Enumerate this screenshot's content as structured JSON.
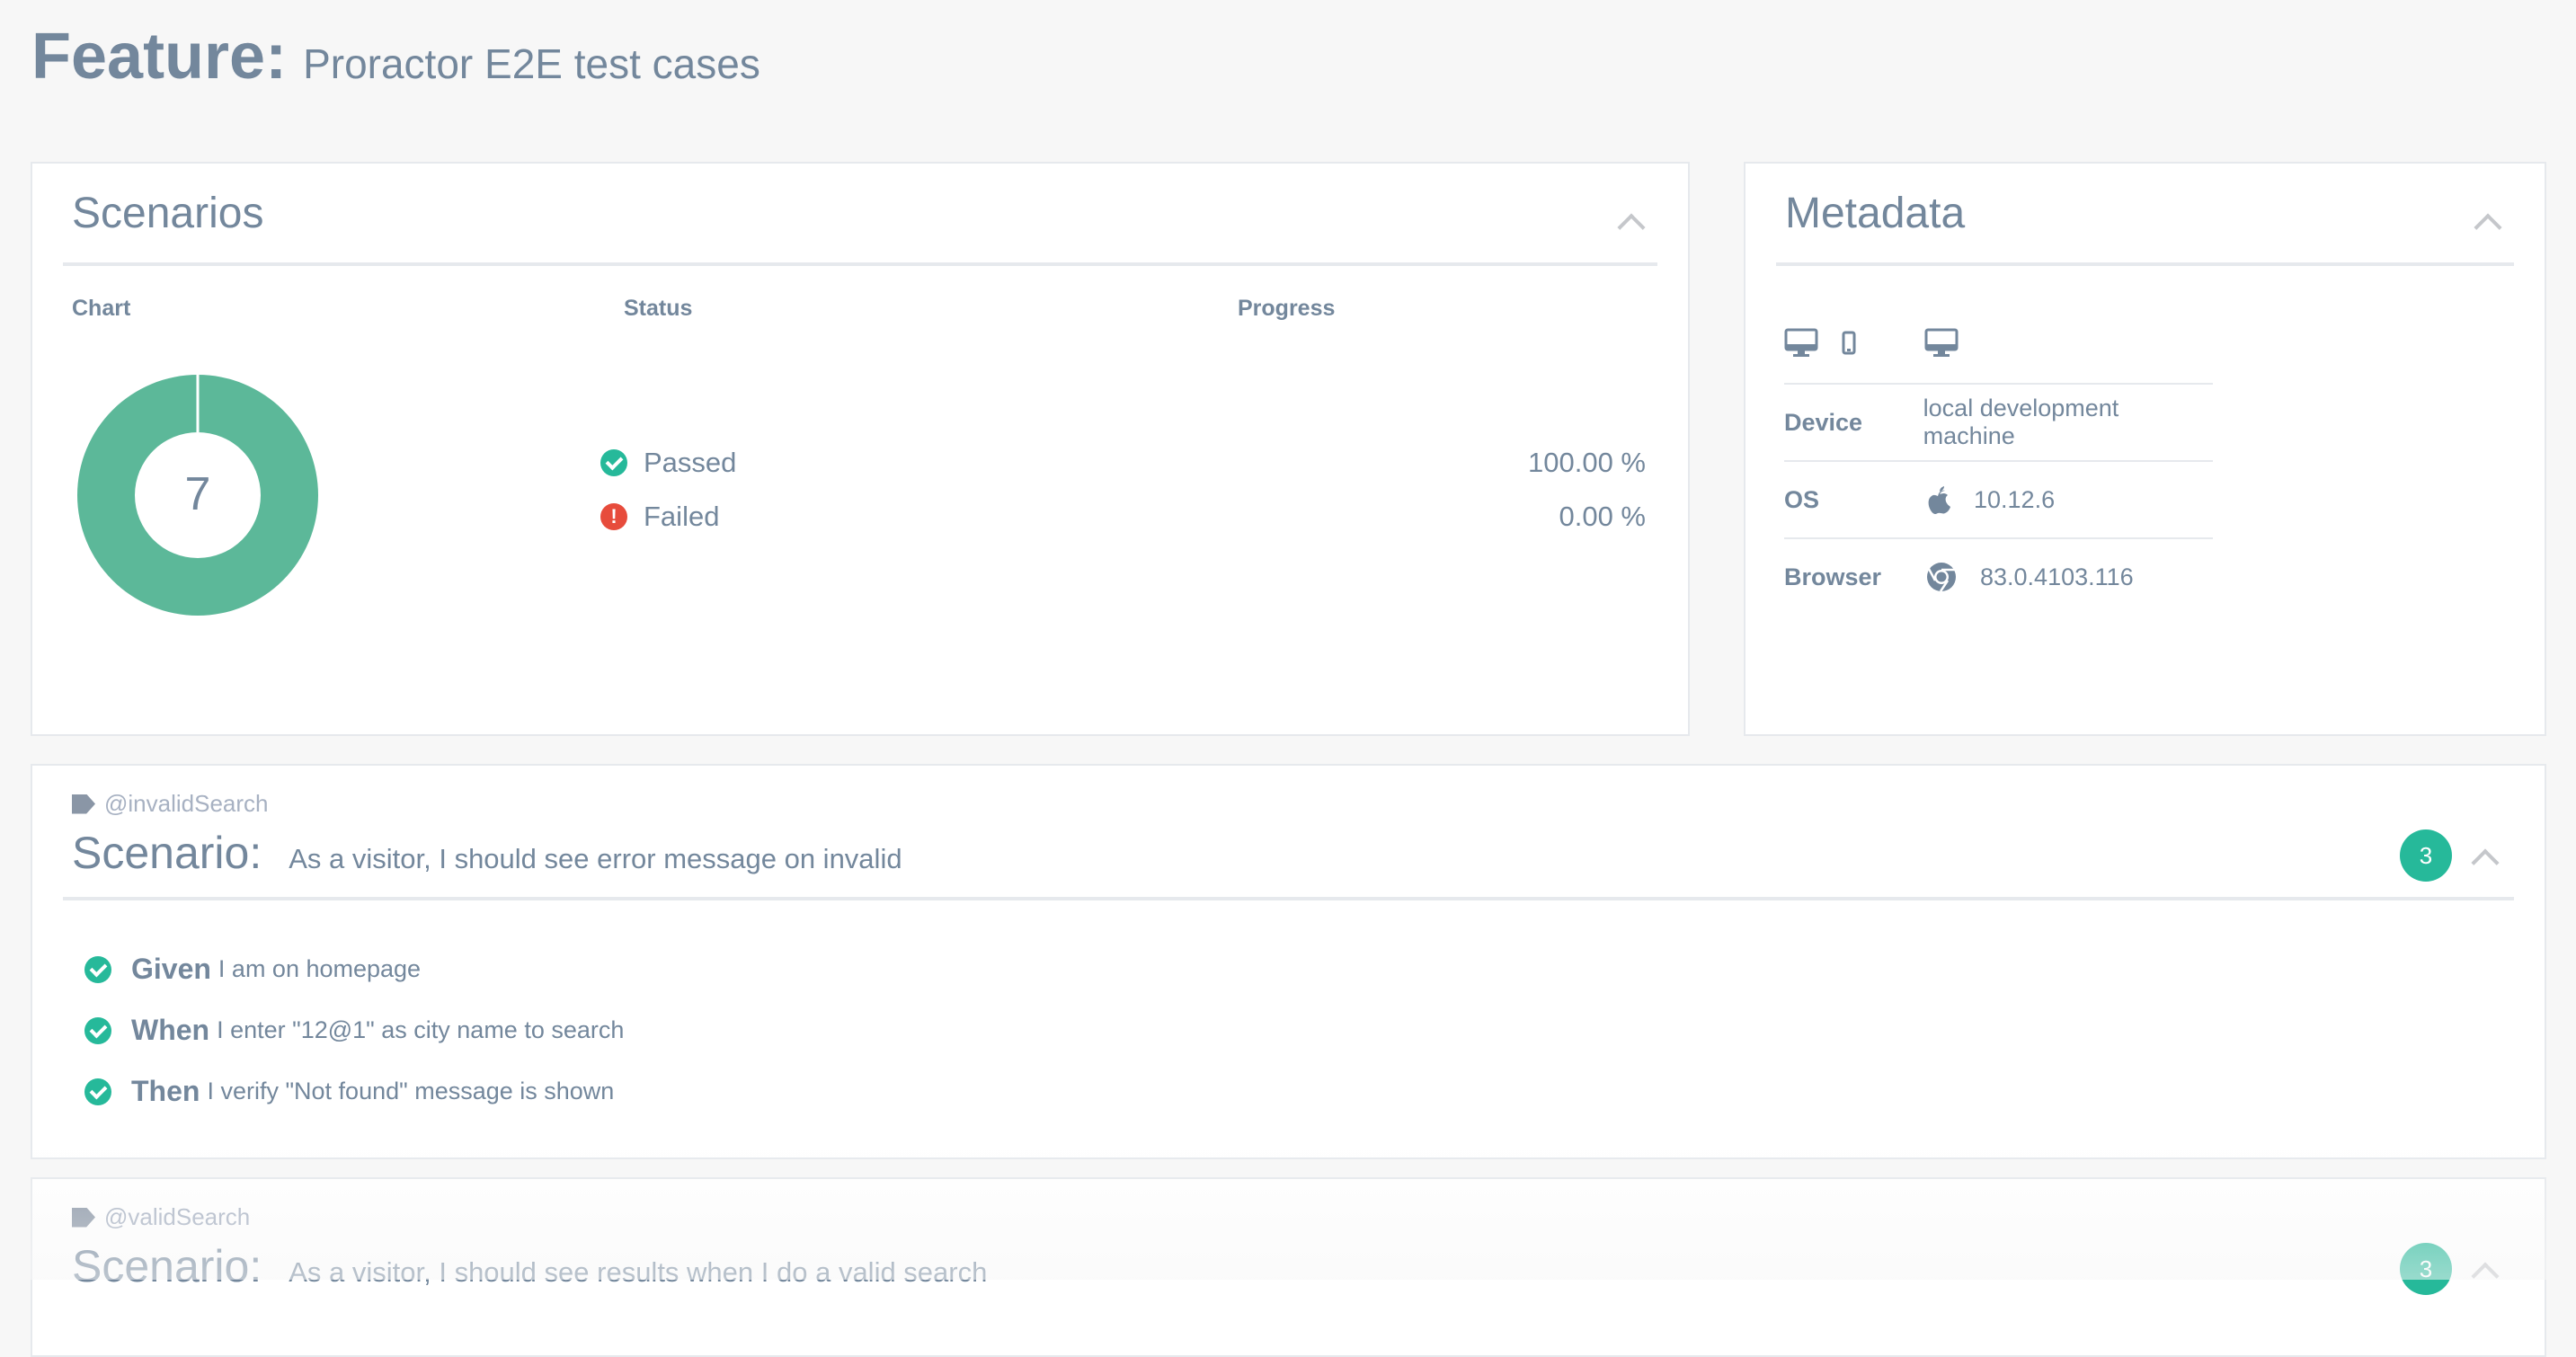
{
  "feature": {
    "keyword": "Feature:",
    "name": "Proractor E2E test cases"
  },
  "scenarios_panel": {
    "title": "Scenarios",
    "columns": {
      "chart": "Chart",
      "status": "Status",
      "progress": "Progress"
    },
    "total": "7",
    "statuses": [
      {
        "label": "Passed",
        "value": "100.00 %",
        "color": "#26b99a"
      },
      {
        "label": "Failed",
        "value": "0.00 %",
        "color": "#e74c3c"
      }
    ]
  },
  "chart_data": {
    "type": "pie",
    "categories": [
      "Passed",
      "Failed"
    ],
    "values": [
      7,
      0
    ],
    "title": "",
    "center_label": "7",
    "colors": [
      "#5cb899",
      "#e74c3c"
    ]
  },
  "metadata_panel": {
    "title": "Metadata",
    "icons": [
      "desktop-icon",
      "mobile-icon",
      "desktop-icon"
    ],
    "rows": [
      {
        "key": "Device",
        "value": "local development machine",
        "icon": ""
      },
      {
        "key": "OS",
        "value": "10.12.6",
        "icon": "apple-icon"
      },
      {
        "key": "Browser",
        "value": "83.0.4103.116",
        "icon": "chrome-icon"
      }
    ]
  },
  "scenario_list": [
    {
      "tag": "@invalidSearch",
      "keyword": "Scenario:",
      "name": "As a visitor, I should see error message on invalid",
      "count": "3",
      "steps": [
        {
          "keyword": "Given",
          "text": "I am on homepage"
        },
        {
          "keyword": "When",
          "text": "I enter \"12@1\" as city name to search"
        },
        {
          "keyword": "Then",
          "text": "I verify \"Not found\" message is shown"
        }
      ]
    },
    {
      "tag": "@validSearch",
      "keyword": "Scenario:",
      "name": "As a visitor, I should see results when I do a valid search",
      "count": "3",
      "steps": []
    }
  ],
  "colors": {
    "accent": "#26b99a",
    "fail": "#e74c3c",
    "text": "#73879c",
    "border": "#e6e9ed"
  }
}
